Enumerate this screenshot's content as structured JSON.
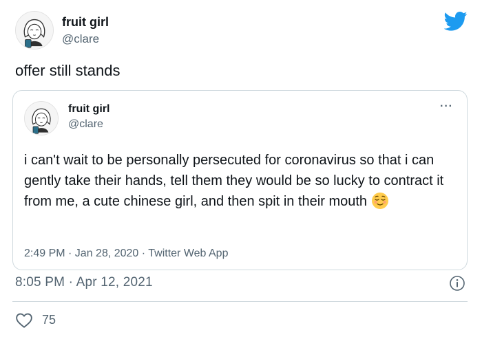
{
  "tweet": {
    "author": {
      "display_name": "fruit girl",
      "handle": "@clare"
    },
    "text": "offer still stands",
    "timestamp": "8:05 PM · Apr 12, 2021",
    "likes": "75"
  },
  "quoted_tweet": {
    "author": {
      "display_name": "fruit girl",
      "handle": "@clare"
    },
    "text": "i can't wait to be personally persecuted for coronavirus so that i can gently take their hands, tell them they would be so lucky to contract it from me, a cute chinese girl, and then spit in their mouth",
    "emoji": "relieved-face",
    "meta": "2:49 PM · Jan 28, 2020 · Twitter Web App",
    "more_label": "···"
  },
  "colors": {
    "brand_blue": "#1d9bf0",
    "text_primary": "#0f1419",
    "text_secondary": "#536471",
    "border": "#cfd9de",
    "emoji_yellow": "#ffcc4d"
  },
  "icons": [
    "avatar-illustration",
    "twitter-bird-icon",
    "ellipsis-icon",
    "info-icon",
    "heart-icon",
    "relieved-face-emoji"
  ]
}
